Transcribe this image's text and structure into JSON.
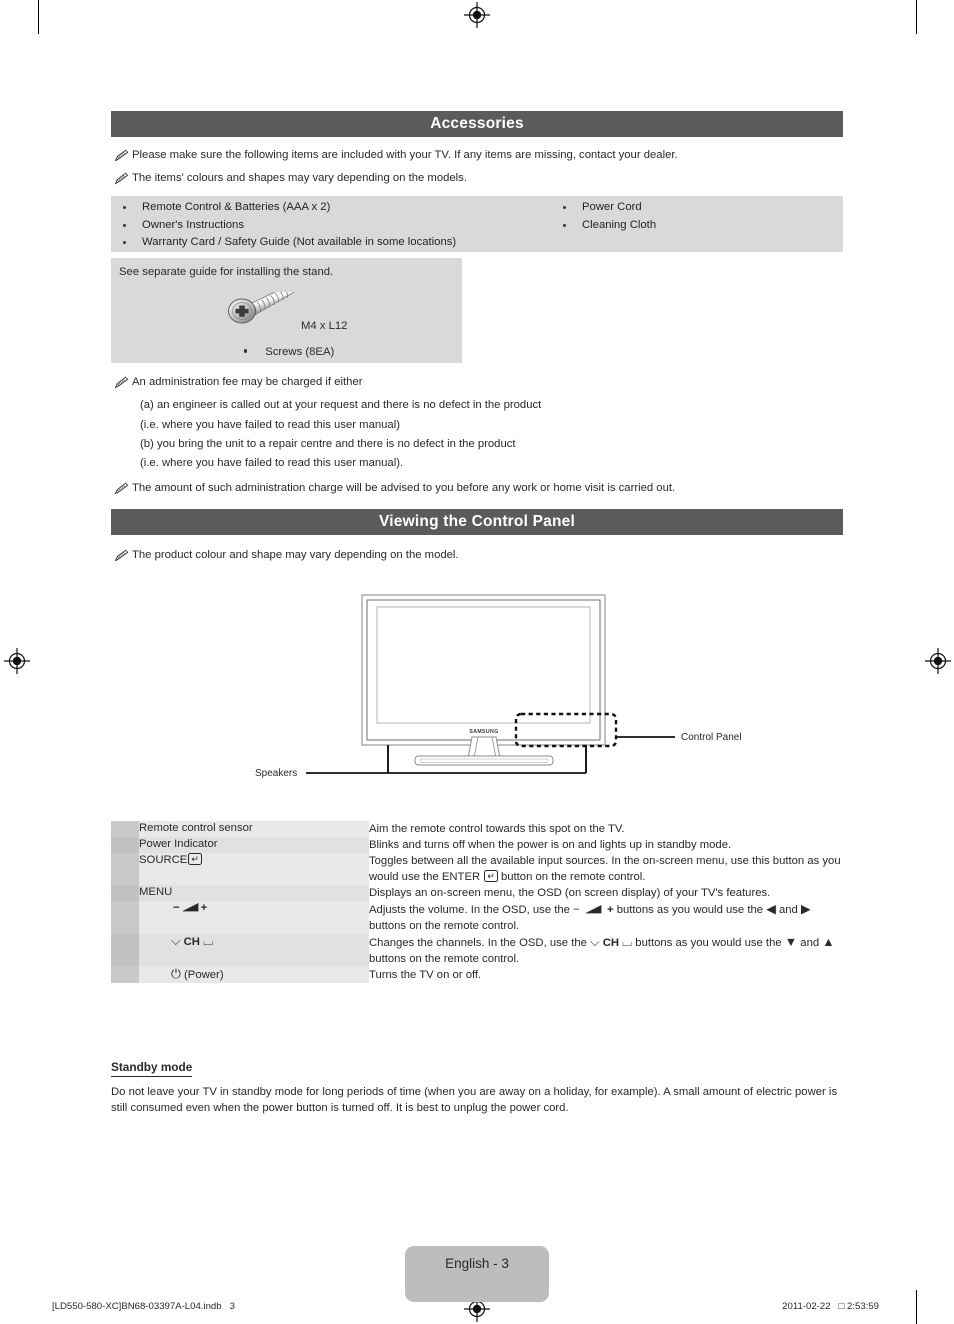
{
  "sections": {
    "accessories_title": "Accessories",
    "control_panel_title": "Viewing the Control Panel"
  },
  "notes": {
    "note1": "Please make sure the following items are included with your TV. If any items are missing, contact your dealer.",
    "note2": "The items' colours and shapes may vary depending on the models.",
    "note3": "An administration fee may be charged if either",
    "note4": "The amount of such administration charge will be advised to you before any work or home visit is carried out.",
    "note5": "The product colour and shape may vary depending on the model."
  },
  "accessories": {
    "left_items": [
      "Remote Control & Batteries (AAA x 2)",
      "Owner's Instructions",
      "Warranty Card / Safety Guide (Not available in some locations)"
    ],
    "right_items": [
      "Power Cord",
      "Cleaning Cloth"
    ]
  },
  "stand_block": {
    "title": "See separate guide for installing the stand.",
    "screw_spec": "M4 x L12",
    "screw_item": "Screws (8EA)",
    "screw_icon": "screw-icon"
  },
  "admin_fee": {
    "lines": [
      "(a) an engineer is called out at your request and there is no defect in the product",
      "(i.e. where you have failed to read this user manual)",
      "(b) you bring the unit to a repair centre and there is no defect in the product",
      "(i.e. where you have failed to read this user manual)."
    ]
  },
  "tv_figure": {
    "brand_label": "SAMSUNG",
    "callout_control_panel": "Control Panel",
    "callout_speakers": "Speakers"
  },
  "control_panel_table": {
    "rows": [
      {
        "label": "Remote control sensor",
        "label_kind": "text",
        "desc_html": "Aim the remote control towards this spot on the TV."
      },
      {
        "label": "Power Indicator",
        "label_kind": "text",
        "desc_html": "Blinks and turns off when the power is on and lights up in standby mode."
      },
      {
        "label": "SOURCE",
        "label_kind": "source",
        "desc_html": "Toggles between all the available input sources. In the on-screen menu, use this button as you would use the ENTER&nbsp;<span class=\"glyph-enter\">&#8629;</span> button on the remote control."
      },
      {
        "label": "MENU",
        "label_kind": "text",
        "desc_html": "Displays an on-screen menu, the OSD (on screen display) of your TV's features."
      },
      {
        "label": "&#8722; &#9205; &#43;",
        "label_kind": "volume",
        "desc_html": "Adjusts the volume. In the OSD, use the &#8722;&nbsp;<span class=\"vol-wedge\"><svg viewBox=\"0 0 17 9\"><polygon points=\"0,8.4 16.4,0 16.4,8.4\" fill=\"#2b2829\"/></svg></span>&nbsp;<b>+</b> buttons as you would use the <span class=\"sym\">&#9664;</span> and <span class=\"sym\">&#9654;</span> buttons on the remote control."
      },
      {
        "label": "CH",
        "label_kind": "channel",
        "desc_html": "Changes the channels. In the OSD, use the <span class=\"sym\">&#9013;</span> <b>CH</b> <span class=\"sym\">&#9012;</span> buttons as you would use the <span class=\"sym\">&#9660;</span> and <span class=\"sym\">&#9650;</span> buttons on the remote control."
      },
      {
        "label": "(Power)",
        "label_kind": "power",
        "desc_html": "Turns the TV on or off."
      }
    ]
  },
  "standby": {
    "title": "Standby mode",
    "body": "Do not leave your TV in standby mode for long periods of time (when you are away on a holiday, for example). A small amount of electric power is still consumed even when the power button is turned off. It is best to unplug the power cord."
  },
  "footer": {
    "page_label": "English - 3",
    "file_name": "[LD550-580-XC]BN68-03397A-L04.indb   3",
    "timestamp": "2011-02-22   □ 2:53:59"
  },
  "colors": {
    "section_bar": "#5c5a5b",
    "accessories_block": "#d9d9d9",
    "table_swatch": "#c9c9c9",
    "table_label": "#e8e8e8",
    "page_pill": "#bdbdbd",
    "text": "#2b2829"
  }
}
